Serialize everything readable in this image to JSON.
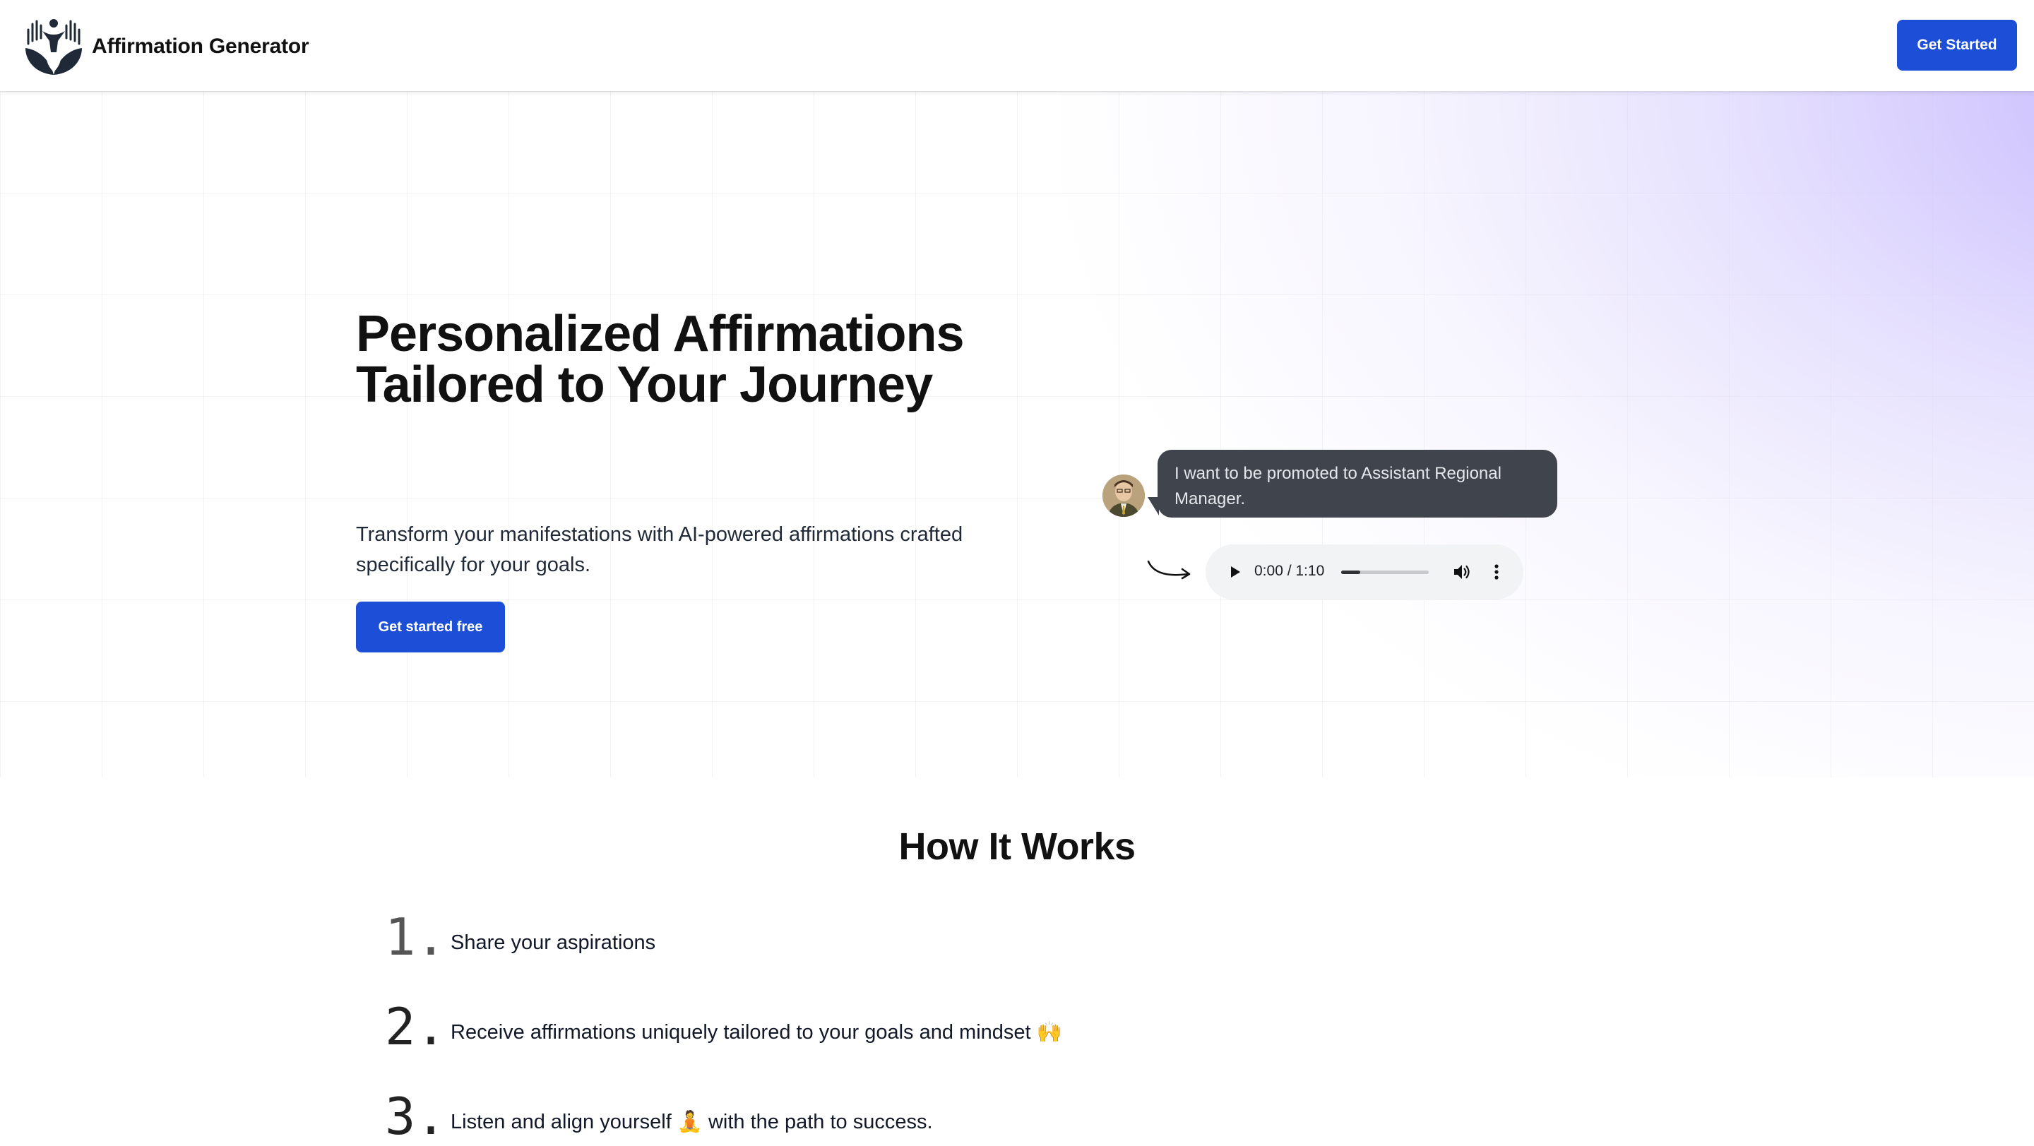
{
  "header": {
    "brand_name": "Affirmation Generator",
    "cta_label": "Get Started"
  },
  "hero": {
    "title_line1": "Personalized Affirmations",
    "title_line2": "Tailored to Your Journey",
    "subtitle": "Transform your manifestations with AI-powered affirmations crafted specifically for your goals.",
    "cta_label": "Get started free"
  },
  "demo": {
    "chat_message": "I want to be promoted to Assistant Regional Manager.",
    "audio": {
      "time_display": "0:00 / 1:10",
      "progress": 0.22
    }
  },
  "how": {
    "title": "How It Works",
    "steps": [
      {
        "number": "1.",
        "text": "Share your aspirations"
      },
      {
        "number": "2.",
        "text": "Receive affirmations uniquely tailored to your goals and mindset 🙌"
      },
      {
        "number": "3.",
        "text": "Listen and align yourself 🧘 with the path to success."
      }
    ]
  },
  "colors": {
    "primary": "#1d4ed8",
    "bubble": "#3f444d",
    "glow": "#c4b5fd"
  },
  "icons": {
    "logo": "lotus-hands-logo",
    "play": "play-icon",
    "volume": "volume-icon",
    "more": "more-vertical-icon",
    "arrow": "curved-arrow-icon"
  }
}
